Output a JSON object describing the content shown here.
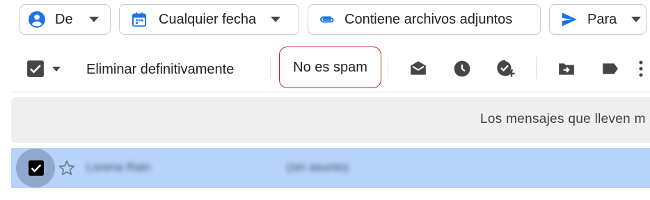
{
  "filters": {
    "from_label": "De",
    "date_label": "Cualquier fecha",
    "attachments_label": "Contiene archivos adjuntos",
    "to_label": "Para"
  },
  "toolbar": {
    "delete_forever_label": "Eliminar definitivamente",
    "not_spam_label": "No es spam",
    "select_all_checked": true,
    "icons": [
      "mark-as-read-icon",
      "snooze-icon",
      "add-to-tasks-icon",
      "move-to-icon",
      "label-icon",
      "more-icon"
    ]
  },
  "banner": {
    "text": "Los mensajes que lleven m"
  },
  "messages": [
    {
      "sender": "Lorena Rain",
      "subject": "(sin asunto)",
      "selected": true,
      "starred": false
    }
  ],
  "colors": {
    "accent_blue": "#1a73e8",
    "selected_row": "#b8d3fa",
    "highlight_red": "#c5221f",
    "icon_gray": "#444746"
  }
}
